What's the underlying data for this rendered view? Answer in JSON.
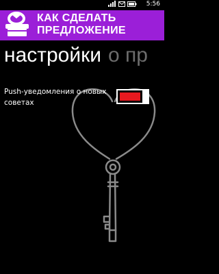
{
  "status": {
    "time": "5:56",
    "icons": [
      "signal-icon",
      "message-icon",
      "battery-icon"
    ]
  },
  "banner": {
    "title": "КАК СДЕЛАТЬ ПРЕДЛОЖЕНИЕ",
    "background": "#9b1fd8",
    "logo": "logo-icon"
  },
  "pivot": {
    "active_tab": "настройки",
    "next_tab": "о пр"
  },
  "settings": {
    "push_label": "Push-уведомления о новых советах",
    "push_toggle": {
      "state": "on",
      "accent": "#e8191f"
    }
  }
}
